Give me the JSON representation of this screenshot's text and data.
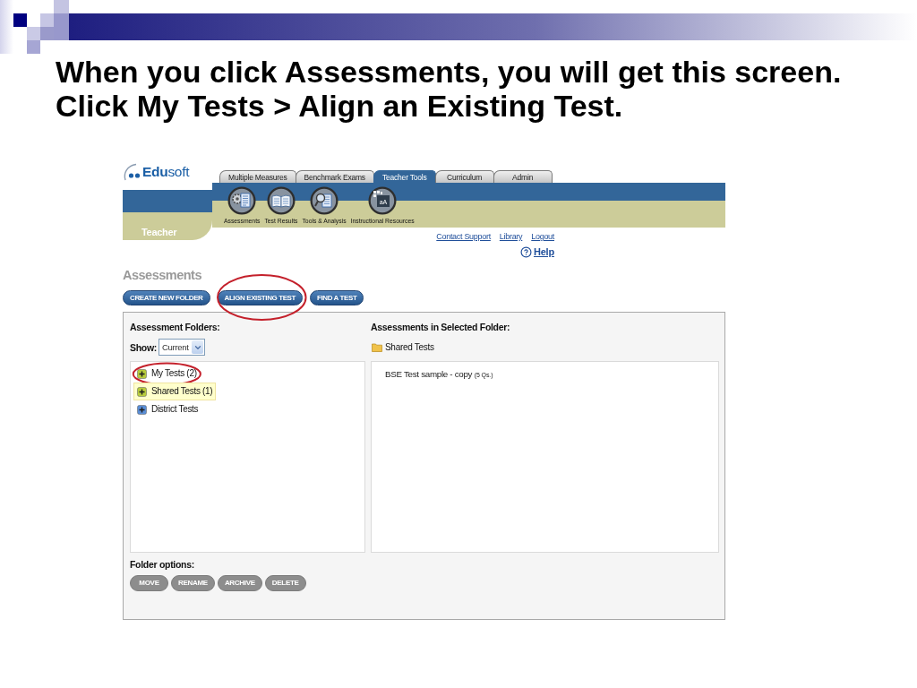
{
  "slide": {
    "title_lines": [
      "When you click Assessments, you will get this screen.",
      "Click My Tests > Align an Existing Test."
    ]
  },
  "app": {
    "logo": "**Edu**soft",
    "tabs": [
      {
        "label": "Multiple Measures",
        "selected": false
      },
      {
        "label": "Benchmark Exams",
        "selected": false
      },
      {
        "label": "Teacher Tools",
        "selected": true
      },
      {
        "label": "Curriculum",
        "selected": false
      },
      {
        "label": "Admin",
        "selected": false
      }
    ],
    "nav_items": [
      {
        "label": "Assessments"
      },
      {
        "label": "Test Results"
      },
      {
        "label": "Tools & Analysis"
      },
      {
        "label": "Instructional Resources",
        "icon_text": "aA"
      }
    ],
    "section_label": "Teacher",
    "links": [
      "Contact Support",
      "Library",
      "Logout"
    ],
    "help_link": "Help",
    "page_title": "Assessments",
    "actions": [
      {
        "label": "CREATE NEW FOLDER",
        "circled": false
      },
      {
        "label": "ALIGN EXISTING TEST",
        "circled": true
      },
      {
        "label": "FIND A TEST",
        "circled": false
      }
    ],
    "folders_panel": {
      "title": "Assessment Folders:",
      "show_label": "Show:",
      "show_value": "Current",
      "folders": [
        {
          "label": "My Tests (2)",
          "selected": false,
          "circled": true,
          "color": "#b8cc3c"
        },
        {
          "label": "Shared Tests (1)",
          "selected": true,
          "circled": false,
          "color": "#b8cc3c"
        },
        {
          "label": "District Tests",
          "selected": false,
          "circled": false,
          "color": "#5a8ed6"
        }
      ]
    },
    "assessments_panel": {
      "title": "Assessments in Selected Folder:",
      "folder": "Shared Tests",
      "items": [
        {
          "name": "BSE Test sample - copy",
          "questions": "(5 Qs.)"
        }
      ]
    },
    "folder_options": {
      "title": "Folder options:",
      "buttons": [
        {
          "label": "MOVE",
          "disabled": true
        },
        {
          "label": "RENAME",
          "disabled": true
        },
        {
          "label": "ARCHIVE",
          "disabled": true
        },
        {
          "label": "DELETE",
          "disabled": true
        }
      ]
    }
  }
}
